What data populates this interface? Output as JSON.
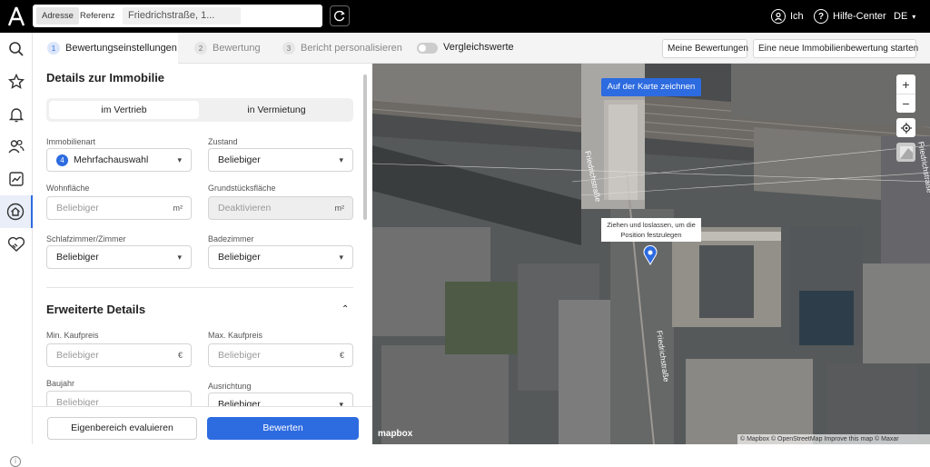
{
  "topbar": {
    "segments": [
      "Adresse",
      "Referenz"
    ],
    "address_value": "Friedrichstraße, 1...",
    "user_label": "Ich",
    "help_label": "Hilfe-Center",
    "language": "DE"
  },
  "nav_icons": [
    "search-icon",
    "star-icon",
    "bell-icon",
    "users-icon",
    "chart-icon",
    "home-valuation-icon",
    "handshake-icon"
  ],
  "steps": [
    {
      "num": "1",
      "label": "Bewertungseinstellungen"
    },
    {
      "num": "2",
      "label": "Bewertung"
    },
    {
      "num": "3",
      "label": "Bericht personalisieren"
    }
  ],
  "compare_label": "Vergleichswerte",
  "actions": {
    "my_valuations": "Meine Bewertungen",
    "new_valuation": "Eine neue Immobilienbewertung starten"
  },
  "panel": {
    "details_title": "Details zur Immobilie",
    "tabs": [
      "im Vertrieb",
      "in Vermietung"
    ],
    "property_type_label": "Immobilienart",
    "property_type_count": "4",
    "property_type_value": "Mehrfachauswahl",
    "condition_label": "Zustand",
    "condition_value": "Beliebiger",
    "living_area_label": "Wohnfläche",
    "living_area_placeholder": "Beliebiger",
    "area_unit": "m²",
    "plot_area_label": "Grundstücksfläche",
    "plot_area_value": "Deaktivieren",
    "rooms_label": "Schlafzimmer/Zimmer",
    "rooms_value": "Beliebiger",
    "baths_label": "Badezimmer",
    "baths_value": "Beliebiger",
    "advanced_title": "Erweiterte Details",
    "min_price_label": "Min. Kaufpreis",
    "max_price_label": "Max. Kaufpreis",
    "price_placeholder": "Beliebiger",
    "currency": "€",
    "year_label": "Baujahr",
    "year_placeholder": "Beliebiger",
    "orientation_label": "Ausrichtung",
    "orientation_value": "Beliebiger"
  },
  "footer": {
    "own_area": "Eigenbereich evaluieren",
    "evaluate": "Bewerten"
  },
  "map": {
    "draw_button": "Auf der Karte zeichnen",
    "tooltip": "Ziehen und loslassen, um die Position festzulegen",
    "street_label": "Friedrichstraße",
    "street_label_2": "Friedrichstraße",
    "street_label_3": "Friedrichstraße",
    "zoom_in": "+",
    "zoom_out": "−",
    "mapbox_logo": "mapbox",
    "attribution": "© Mapbox © OpenStreetMap Improve this map © Maxar"
  }
}
